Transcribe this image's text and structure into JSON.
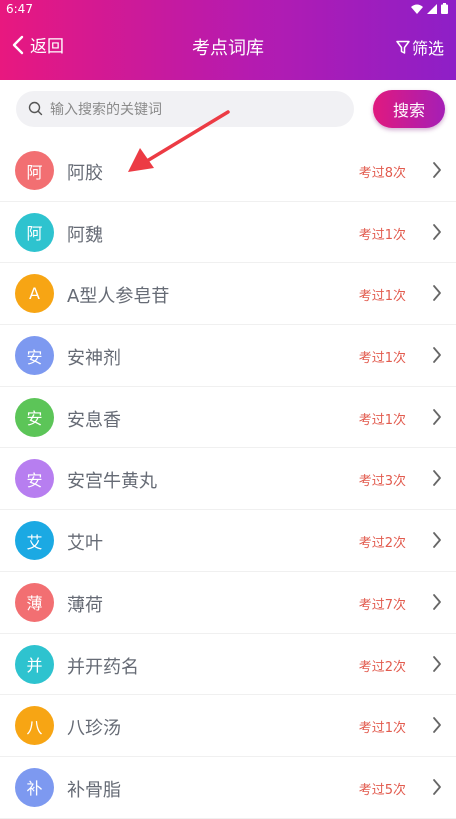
{
  "status": {
    "time": "6:47"
  },
  "nav": {
    "back_label": "返回",
    "title": "考点词库",
    "filter_label": "筛选"
  },
  "search": {
    "placeholder": "输入搜索的关键词",
    "value": "",
    "button_label": "搜索"
  },
  "colors": {
    "header_start": "#e8187f",
    "header_end": "#8e1fc7",
    "count_red": "#e25b4e",
    "arrow_red": "#ec3b44"
  },
  "items": [
    {
      "avatar": "阿",
      "name": "阿胶",
      "count": "考过8次",
      "avatar_color": "#f26f72"
    },
    {
      "avatar": "阿",
      "name": "阿魏",
      "count": "考过1次",
      "avatar_color": "#2ec3cf"
    },
    {
      "avatar": "A",
      "name": "A型人参皂苷",
      "count": "考过1次",
      "avatar_color": "#f7a514"
    },
    {
      "avatar": "安",
      "name": "安神剂",
      "count": "考过1次",
      "avatar_color": "#7d99f0"
    },
    {
      "avatar": "安",
      "name": "安息香",
      "count": "考过1次",
      "avatar_color": "#5cc558"
    },
    {
      "avatar": "安",
      "name": "安宫牛黄丸",
      "count": "考过3次",
      "avatar_color": "#b77ef0"
    },
    {
      "avatar": "艾",
      "name": "艾叶",
      "count": "考过2次",
      "avatar_color": "#1ba9e3"
    },
    {
      "avatar": "薄",
      "name": "薄荷",
      "count": "考过7次",
      "avatar_color": "#f26f72"
    },
    {
      "avatar": "并",
      "name": "并开药名",
      "count": "考过2次",
      "avatar_color": "#2ec3cf"
    },
    {
      "avatar": "八",
      "name": "八珍汤",
      "count": "考过1次",
      "avatar_color": "#f7a514"
    },
    {
      "avatar": "补",
      "name": "补骨脂",
      "count": "考过5次",
      "avatar_color": "#7d99f0"
    }
  ]
}
